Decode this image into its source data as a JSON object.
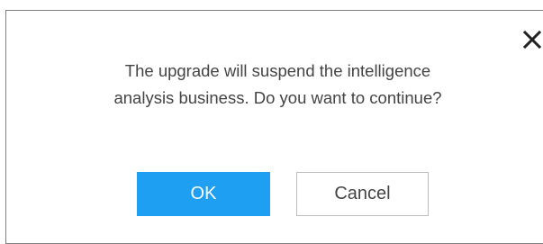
{
  "dialog": {
    "message_line1": "The upgrade will suspend the intelligence",
    "message_line2": "analysis business. Do you want to continue?",
    "ok_label": "OK",
    "cancel_label": "Cancel",
    "close_icon": "close-icon"
  },
  "colors": {
    "primary": "#1e9ff2",
    "text": "#444444",
    "border": "#7f7f7f"
  }
}
